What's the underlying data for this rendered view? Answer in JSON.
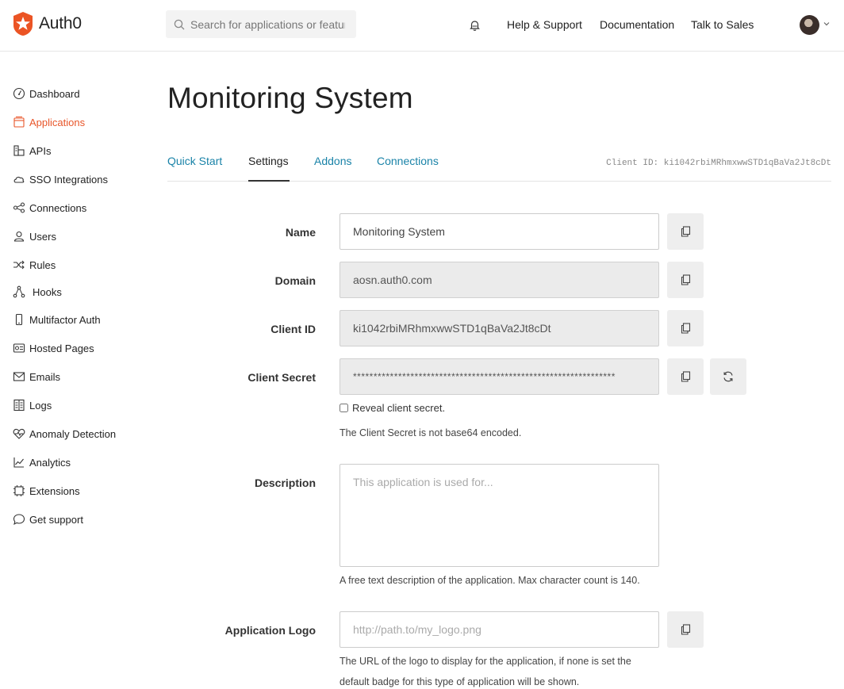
{
  "brand": {
    "name": "Auth0",
    "accent": "#eb5424"
  },
  "header": {
    "search_placeholder": "Search for applications or features",
    "nav": [
      "Help & Support",
      "Documentation",
      "Talk to Sales"
    ]
  },
  "sidebar": {
    "items": [
      {
        "label": "Dashboard",
        "icon": "dashboard-icon"
      },
      {
        "label": "Applications",
        "icon": "applications-icon",
        "active": true
      },
      {
        "label": "APIs",
        "icon": "apis-icon"
      },
      {
        "label": "SSO Integrations",
        "icon": "cloud-icon"
      },
      {
        "label": "Connections",
        "icon": "connections-icon"
      },
      {
        "label": "Users",
        "icon": "users-icon"
      },
      {
        "label": "Rules",
        "icon": "rules-icon"
      },
      {
        "label": "Hooks",
        "icon": "hooks-icon"
      },
      {
        "label": "Multifactor Auth",
        "icon": "phone-icon"
      },
      {
        "label": "Hosted Pages",
        "icon": "hosted-pages-icon"
      },
      {
        "label": "Emails",
        "icon": "email-icon"
      },
      {
        "label": "Logs",
        "icon": "logs-icon"
      },
      {
        "label": "Anomaly Detection",
        "icon": "heart-icon"
      },
      {
        "label": "Analytics",
        "icon": "analytics-icon"
      },
      {
        "label": "Extensions",
        "icon": "extensions-icon"
      },
      {
        "label": "Get support",
        "icon": "chat-icon"
      }
    ]
  },
  "page": {
    "title": "Monitoring System",
    "tabs": [
      "Quick Start",
      "Settings",
      "Addons",
      "Connections"
    ],
    "active_tab": "Settings",
    "client_id_header": "Client ID: ki1042rbiMRhmxwwSTD1qBaVa2Jt8cDt"
  },
  "form": {
    "name": {
      "label": "Name",
      "value": "Monitoring System"
    },
    "domain": {
      "label": "Domain",
      "value": "aosn.auth0.com"
    },
    "client_id": {
      "label": "Client ID",
      "value": "ki1042rbiMRhmxwwSTD1qBaVa2Jt8cDt"
    },
    "client_secret": {
      "label": "Client Secret",
      "value": "****************************************************************",
      "reveal_label": "Reveal client secret.",
      "note": "The Client Secret is not base64 encoded."
    },
    "description": {
      "label": "Description",
      "placeholder": "This application is used for...",
      "help": "A free text description of the application. Max character count is 140."
    },
    "logo": {
      "label": "Application Logo",
      "placeholder": "http://path.to/my_logo.png",
      "help_line1": "The URL of the logo to display for the application, if none is set the",
      "help_line2": "default badge for this type of application will be shown."
    }
  }
}
